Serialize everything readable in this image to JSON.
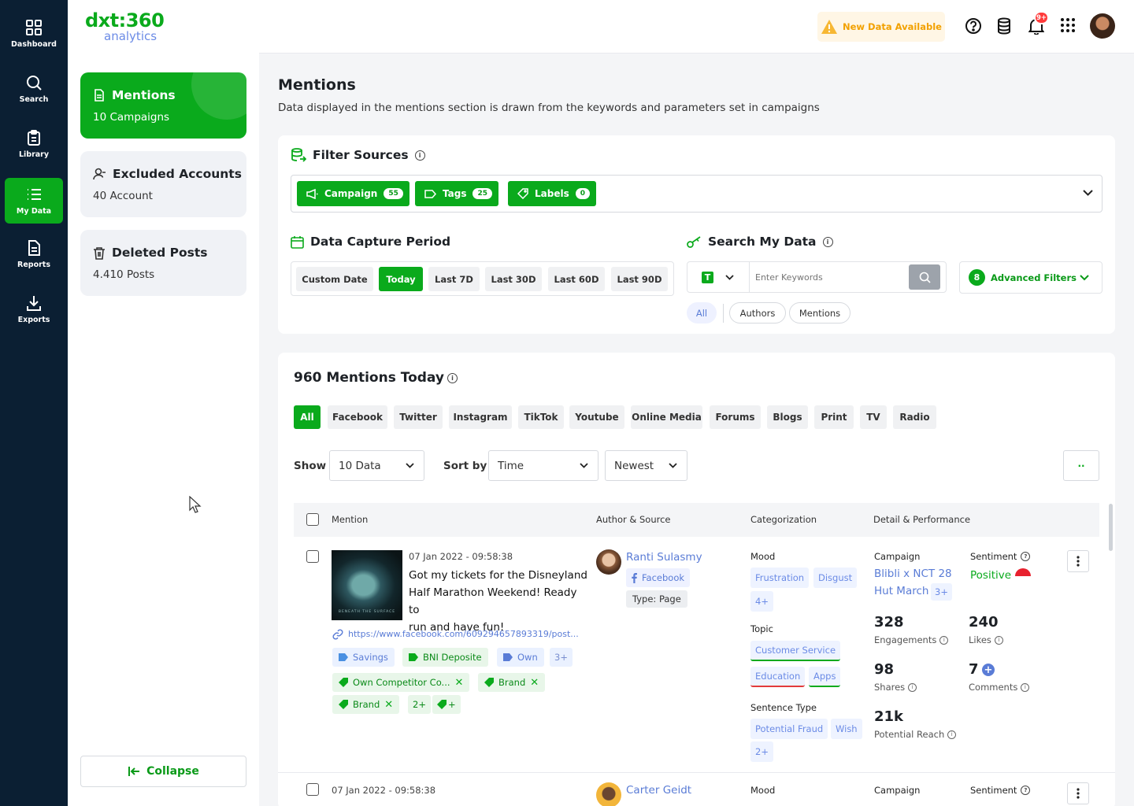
{
  "nav": {
    "items": [
      {
        "label": "Dashboard",
        "icon": "grid-icon"
      },
      {
        "label": "Search",
        "icon": "search-icon"
      },
      {
        "label": "Library",
        "icon": "clipboard-icon"
      },
      {
        "label": "My Data",
        "icon": "list-icon"
      },
      {
        "label": "Reports",
        "icon": "document-icon"
      },
      {
        "label": "Exports",
        "icon": "download-icon"
      }
    ]
  },
  "logo": {
    "top": "dxt:360",
    "bottom": "analytics"
  },
  "panel": {
    "cards": [
      {
        "title": "Mentions",
        "sub": "10 Campaigns"
      },
      {
        "title": "Excluded Accounts",
        "sub": "40 Account"
      },
      {
        "title": "Deleted Posts",
        "sub": "4.410 Posts"
      }
    ],
    "collapse": "Collapse"
  },
  "topbar": {
    "new_data": "New Data Available",
    "notif_badge": "9+"
  },
  "page": {
    "title": "Mentions",
    "subtitle": "Data displayed in the mentions section is drawn from the keywords and parameters set in campaigns"
  },
  "filters": {
    "title": "Filter Sources",
    "pills": [
      {
        "label": "Campaign",
        "count": "55"
      },
      {
        "label": "Tags",
        "count": "25"
      },
      {
        "label": "Labels",
        "count": "0"
      }
    ],
    "period_title": "Data Capture Period",
    "periods": [
      "Custom Date",
      "Today",
      "Last 7D",
      "Last 30D",
      "Last 60D",
      "Last 90D"
    ],
    "search_title": "Search My Data",
    "type_badge": "T",
    "keywords_placeholder": "Enter Keywords",
    "advanced_count": "8",
    "advanced_label": "Advanced Filters",
    "chips": [
      "All",
      "Authors",
      "Mentions"
    ]
  },
  "mentions": {
    "title": "960 Mentions Today",
    "tabs": [
      "All",
      "Facebook",
      "Twitter",
      "Instagram",
      "TikTok",
      "Youtube",
      "Online Media",
      "Forums",
      "Blogs",
      "Print",
      "TV",
      "Radio"
    ],
    "show_label": "Show",
    "show_value": "10 Data",
    "sort_label": "Sort by",
    "sort_value": "Time",
    "order_value": "Newest",
    "more_btn": "··",
    "columns": [
      "Mention",
      "Author & Source",
      "Categorization",
      "Detail & Performance"
    ],
    "rows": [
      {
        "time": "07 Jan 2022 - 09:58:38",
        "text": [
          "Got my tickets for the Disneyland",
          "Half Marathon Weekend! Ready to",
          "run and have fun!"
        ],
        "thumb_caption": "BENEATH THE SURFACE",
        "link": "https://www.facebook.com/609294657893319/post...",
        "tags1": [
          "Savings",
          "BNI Deposite",
          "Own",
          "3+"
        ],
        "tags2": [
          "Own Competitor Co...",
          "Brand"
        ],
        "tags3": [
          "Brand",
          "2+",
          "+"
        ],
        "author": "Ranti Sulasmy",
        "source": "Facebook",
        "type": "Type: Page",
        "mood_label": "Mood",
        "mood": [
          "Frustration",
          "Disgust",
          "4+"
        ],
        "topic_label": "Topic",
        "topic": [
          "Customer Service",
          "Education",
          "Apps"
        ],
        "sentence_label": "Sentence Type",
        "sentence": [
          "Potential Fraud",
          "Wish",
          "2+"
        ],
        "campaign_label": "Campaign",
        "campaign": [
          "Blibli x NCT 28",
          "Hut March"
        ],
        "campaign_more": "3+",
        "sentiment_label": "Sentiment",
        "sentiment": "Positive",
        "engagements": "328",
        "engagements_label": "Engagements",
        "likes": "240",
        "likes_label": "Likes",
        "shares": "98",
        "shares_label": "Shares",
        "comments": "7",
        "comments_label": "Comments",
        "reach": "21k",
        "reach_label": "Potential Reach"
      },
      {
        "time": "07 Jan 2022 - 09:58:38",
        "author": "Carter Geidt",
        "mood_label": "Mood",
        "campaign_label": "Campaign",
        "sentiment_label": "Sentiment"
      }
    ]
  },
  "colors": {
    "brand": "#0aaa1c",
    "nav_bg": "#0b1f33",
    "link": "#5a7cd6",
    "warning": "#f2a100"
  }
}
